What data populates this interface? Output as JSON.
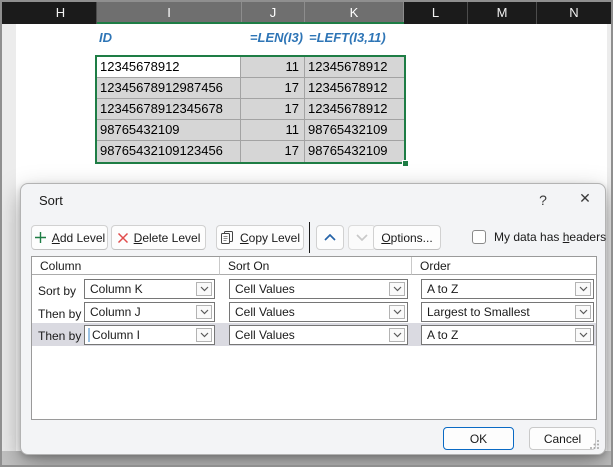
{
  "spreadsheet": {
    "column_headers": [
      "H",
      "I",
      "J",
      "K",
      "L",
      "M",
      "N"
    ],
    "selected_columns": [
      "I",
      "J",
      "K"
    ],
    "formula_row": {
      "id_label": "ID",
      "len_formula": "=LEN(I3)",
      "left_formula": "=LEFT(I3,11)"
    },
    "table": {
      "rows": [
        [
          "12345678912",
          "11",
          "12345678912"
        ],
        [
          "12345678912987456",
          "17",
          "12345678912"
        ],
        [
          "12345678912345678",
          "17",
          "12345678912"
        ],
        [
          "98765432109",
          "11",
          "98765432109"
        ],
        [
          "98765432109123456",
          "17",
          "98765432109"
        ]
      ]
    }
  },
  "dialog": {
    "title": "Sort",
    "help_glyph": "?",
    "close_glyph": "✕",
    "toolbar": {
      "add": {
        "accel": "A",
        "rest": "dd Level"
      },
      "delete": {
        "accel": "D",
        "rest": "elete Level"
      },
      "copy": {
        "accel": "C",
        "rest": "opy Level"
      },
      "options": {
        "accel": "O",
        "rest": "ptions..."
      },
      "headers_checkbox": {
        "pre": "My data has ",
        "accel": "h",
        "rest": "eaders",
        "checked": false
      }
    },
    "levels": {
      "column_header": "Column",
      "sort_on_header": "Sort On",
      "order_header": "Order",
      "rows": [
        {
          "label": "Sort by",
          "column": "Column K",
          "sort_on": "Cell Values",
          "order": "A to Z",
          "selected": false
        },
        {
          "label": "Then by",
          "column": "Column J",
          "sort_on": "Cell Values",
          "order": "Largest to Smallest",
          "selected": false
        },
        {
          "label": "Then by",
          "column": "Column I",
          "sort_on": "Cell Values",
          "order": "A to Z",
          "selected": true
        }
      ]
    },
    "footer": {
      "ok_label": "OK",
      "cancel_label": "Cancel"
    }
  },
  "colors": {
    "excel_green": "#1e7d45",
    "formula_blue": "#2e75b6",
    "header_dark": "#1b1b1b",
    "header_selected_gray": "#6f6f6f",
    "selection_fill": "#d6d6d6",
    "dialog_bg": "#f3f4f6",
    "row_highlight": "#dadae1",
    "ok_button_border": "#0a6ac4",
    "add_icon_green": "#1e7d45",
    "delete_icon_red": "#e14b4b",
    "up_chevron_blue": "#2563a8"
  }
}
